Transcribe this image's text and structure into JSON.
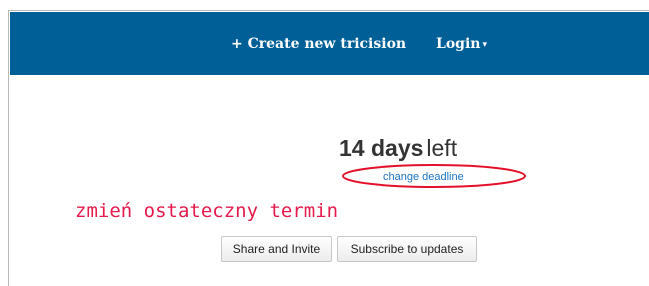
{
  "navbar": {
    "create_label": "+ Create new tricision",
    "login_label": "Login",
    "login_caret": "▾",
    "background": "#005f96"
  },
  "deadline": {
    "days_text": "14 days",
    "left_text": "left",
    "change_link": "change deadline"
  },
  "annotation": {
    "text": "zmień ostateczny termin",
    "color": "#e51a4c"
  },
  "buttons": {
    "share": "Share and Invite",
    "subscribe": "Subscribe to updates"
  }
}
